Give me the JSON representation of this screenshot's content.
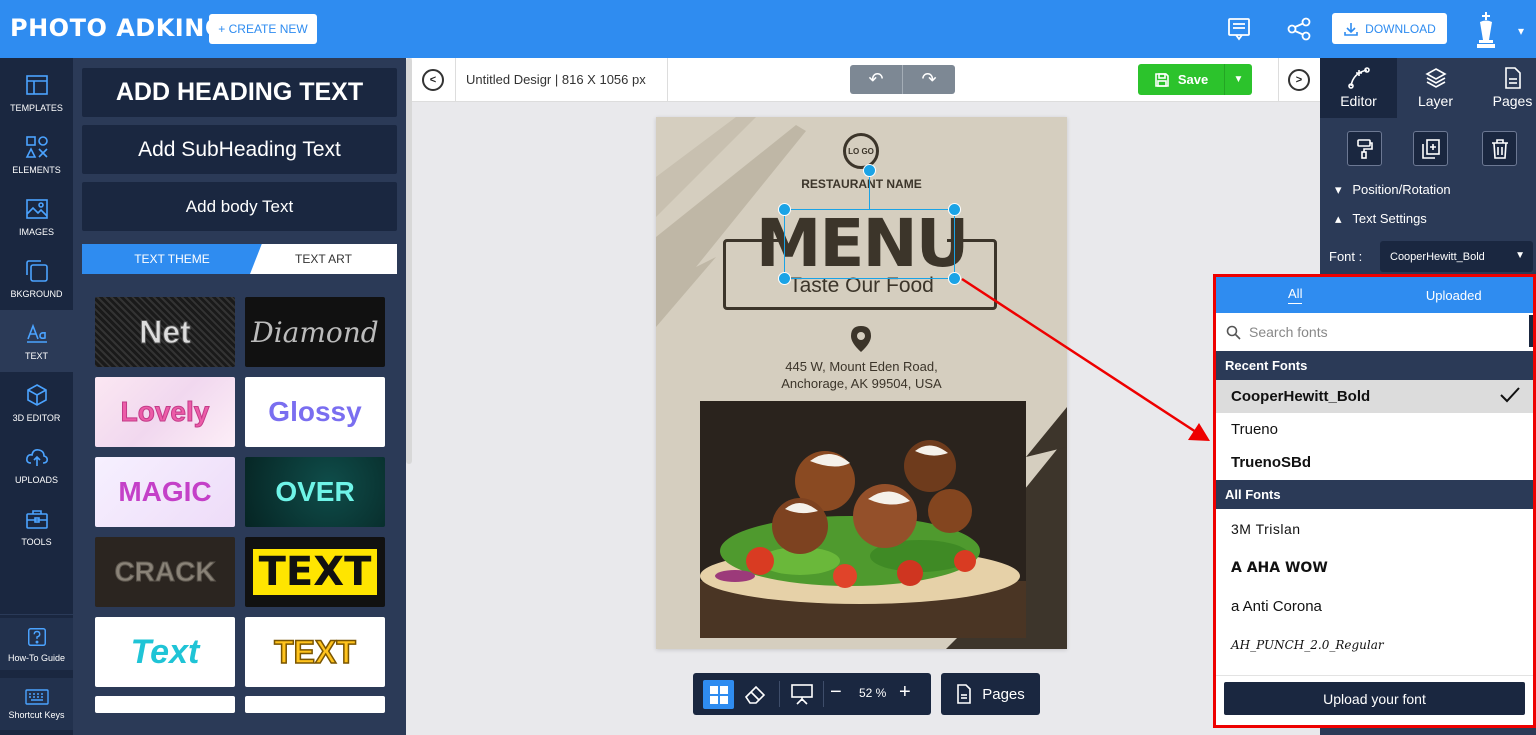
{
  "header": {
    "logo": "PHOTO ADKING",
    "create_new": "+ CREATE NEW",
    "download": "DOWNLOAD"
  },
  "nav": {
    "items": [
      {
        "label": "TEMPLATES",
        "icon": "templates-icon"
      },
      {
        "label": "ELEMENTS",
        "icon": "elements-icon"
      },
      {
        "label": "IMAGES",
        "icon": "images-icon"
      },
      {
        "label": "BKGROUND",
        "icon": "background-icon"
      },
      {
        "label": "TEXT",
        "icon": "text-icon",
        "active": true
      },
      {
        "label": "3D EDITOR",
        "icon": "cube-icon"
      },
      {
        "label": "UPLOADS",
        "icon": "upload-cloud-icon"
      },
      {
        "label": "TOOLS",
        "icon": "toolbox-icon"
      }
    ],
    "bottom": [
      {
        "label": "How-To Guide",
        "icon": "help-icon"
      },
      {
        "label": "Shortcut Keys",
        "icon": "keyboard-icon"
      }
    ]
  },
  "text_panel": {
    "heading": "ADD HEADING TEXT",
    "subheading": "Add SubHeading Text",
    "body": "Add body Text",
    "tabs": [
      "TEXT THEME",
      "TEXT ART"
    ],
    "themes": [
      "Net",
      "Diamond",
      "Lovely",
      "Glossy",
      "MAGIC",
      "OVER",
      "CRACK",
      "TEXT",
      "Text",
      "TEXT"
    ]
  },
  "toolbar": {
    "title": "Untitled Desigr",
    "dimensions": "| 816 X 1056 px",
    "save": "Save"
  },
  "design": {
    "logo": "LO GO",
    "restaurant": "RESTAURANT NAME",
    "menu": "MENU",
    "tagline": "Taste Our Food",
    "address_line1": "445 W, Mount Eden Road,",
    "address_line2": "Anchorage, AK 99504, USA"
  },
  "canvas_bottom": {
    "zoom": "52 %",
    "pages": "Pages"
  },
  "right_panel": {
    "tabs": [
      "Editor",
      "Layer",
      "Pages"
    ],
    "position_rotation": "Position/Rotation",
    "text_settings": "Text Settings",
    "font_label": "Font :",
    "font_value": "CooperHewitt_Bold"
  },
  "font_dropdown": {
    "tabs": [
      "All",
      "Uploaded"
    ],
    "search_placeholder": "Search fonts",
    "recent_header": "Recent Fonts",
    "recent": [
      "CooperHewitt_Bold",
      "Trueno",
      "TruenoSBd"
    ],
    "all_header": "All Fonts",
    "all": [
      "3M Trislan",
      "A AHA WOW",
      "a Anti Corona",
      "AH_PUNCH_2.0_Regular"
    ],
    "upload": "Upload your font"
  },
  "colors": {
    "brand_blue": "#2f8cf0",
    "navy": "#1a2740",
    "panel": "#2b3a57",
    "save_green": "#2cc32c",
    "highlight_red": "#ee0000"
  }
}
